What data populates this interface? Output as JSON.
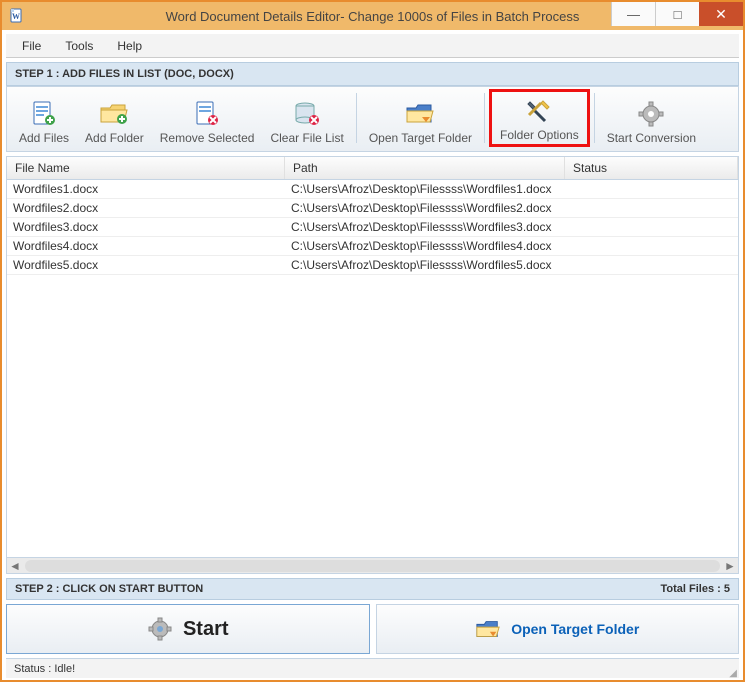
{
  "window": {
    "title": "Word Document Details Editor- Change 1000s of Files in Batch Process"
  },
  "menu": {
    "file": "File",
    "tools": "Tools",
    "help": "Help"
  },
  "step1": {
    "label": "STEP 1 : ADD FILES IN LIST (DOC, DOCX)"
  },
  "toolbar": {
    "addFiles": "Add Files",
    "addFolder": "Add Folder",
    "removeSelected": "Remove Selected",
    "clearFileList": "Clear File List",
    "openTargetFolder": "Open Target Folder",
    "folderOptions": "Folder Options",
    "startConversion": "Start Conversion"
  },
  "columns": {
    "fileName": "File Name",
    "path": "Path",
    "status": "Status"
  },
  "rows": [
    {
      "fileName": "Wordfiles1.docx",
      "path": "C:\\Users\\Afroz\\Desktop\\Filessss\\Wordfiles1.docx",
      "status": ""
    },
    {
      "fileName": "Wordfiles2.docx",
      "path": "C:\\Users\\Afroz\\Desktop\\Filessss\\Wordfiles2.docx",
      "status": ""
    },
    {
      "fileName": "Wordfiles3.docx",
      "path": "C:\\Users\\Afroz\\Desktop\\Filessss\\Wordfiles3.docx",
      "status": ""
    },
    {
      "fileName": "Wordfiles4.docx",
      "path": "C:\\Users\\Afroz\\Desktop\\Filessss\\Wordfiles4.docx",
      "status": ""
    },
    {
      "fileName": "Wordfiles5.docx",
      "path": "C:\\Users\\Afroz\\Desktop\\Filessss\\Wordfiles5.docx",
      "status": ""
    }
  ],
  "step2": {
    "label": "STEP 2 : CLICK ON START BUTTON",
    "total": "Total Files : 5"
  },
  "buttons": {
    "start": "Start",
    "openTarget": "Open Target Folder"
  },
  "status": {
    "text": "Status  :  Idle!"
  }
}
